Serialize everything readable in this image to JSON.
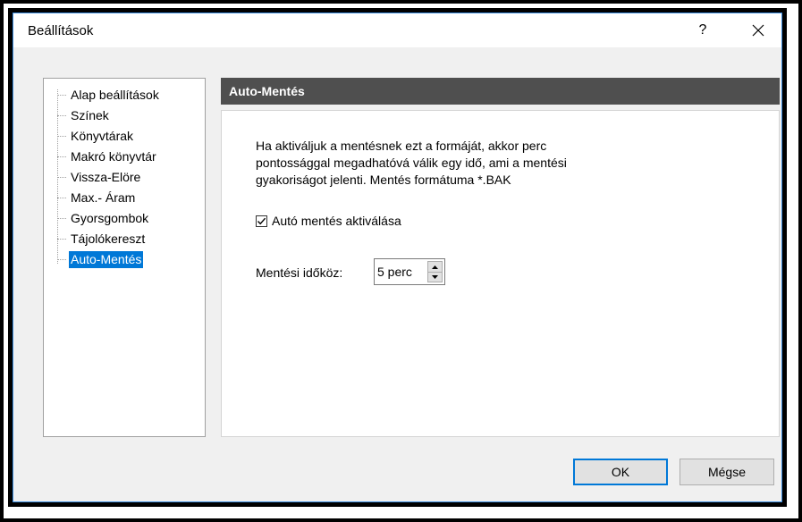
{
  "window": {
    "title": "Beállítások",
    "help_label": "?",
    "close_icon": "close-icon"
  },
  "tree": {
    "items": [
      {
        "label": "Alap beállítások",
        "selected": false
      },
      {
        "label": "Színek",
        "selected": false
      },
      {
        "label": "Könyvtárak",
        "selected": false
      },
      {
        "label": "Makró könyvtár",
        "selected": false
      },
      {
        "label": "Vissza-Elöre",
        "selected": false
      },
      {
        "label": "Max.- Áram",
        "selected": false
      },
      {
        "label": "Gyorsgombok",
        "selected": false
      },
      {
        "label": "Tájolókereszt",
        "selected": false
      },
      {
        "label": "Auto-Mentés",
        "selected": true
      }
    ]
  },
  "panel": {
    "header": "Auto-Mentés",
    "description_lines": [
      "Ha aktiváljuk a mentésnek ezt a formáját, akkor perc",
      "pontossággal megadhatóvá válik egy idő, ami a mentési",
      "gyakoriságot jelenti. Mentés formátuma *.BAK"
    ],
    "autosave_checkbox": {
      "label": "Autó mentés aktiválása",
      "checked": true
    },
    "interval": {
      "label": "Mentési időköz:",
      "value": "5 perc"
    }
  },
  "buttons": {
    "ok": "OK",
    "cancel": "Mégse"
  },
  "colors": {
    "accent": "#0078d7",
    "header_bg": "#4f4f4f"
  }
}
